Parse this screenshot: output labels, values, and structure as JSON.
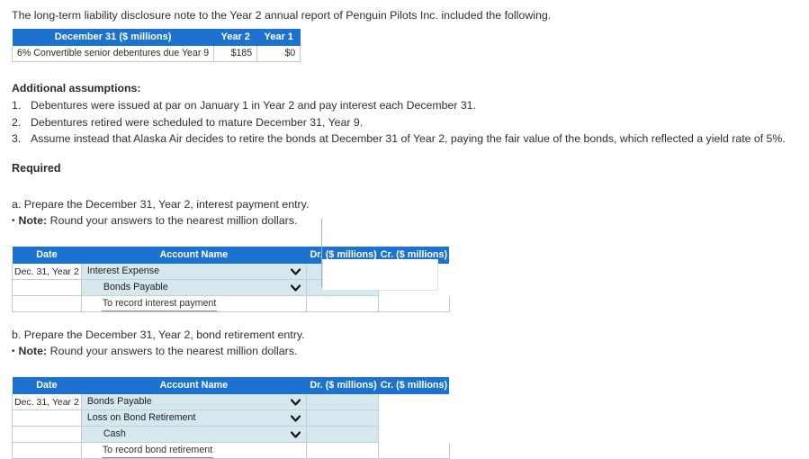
{
  "intro": {
    "text": "The long-term liability disclosure note to the Year 2 annual report of Penguin Pilots Inc. included the following."
  },
  "disclosure_table": {
    "headers": [
      "December 31 ($ millions)",
      "Year 2",
      "Year 1"
    ],
    "rows": [
      {
        "description": "6% Convertible senior debentures due Year 9",
        "year2": "$185",
        "year1": "$0"
      }
    ]
  },
  "assumptions": {
    "title": "Additional assumptions:",
    "items": [
      {
        "num": "1.",
        "text": "Debentures were issued at par on January 1 in Year 2 and pay interest each December 31."
      },
      {
        "num": "2.",
        "text": "Debentures retired were scheduled to mature December 31, Year 9."
      },
      {
        "num": "3.",
        "text": "Assume instead that Alaska Air decides to retire the bonds at December 31 of Year 2, paying the fair value of the bonds, which reflected a yield rate of 5%."
      }
    ]
  },
  "required": {
    "heading": "Required"
  },
  "part_a": {
    "prompt": "a. Prepare the December 31, Year 2, interest payment entry.",
    "bullet": "•",
    "note_label": "Note:",
    "note_text": "Round your answers to the nearest million dollars.",
    "table": {
      "headers": [
        "Date",
        "Account Name",
        "Dr. ($ millions)",
        "Cr. ($ millions)"
      ],
      "rows": [
        {
          "date": "Dec. 31, Year 2",
          "account": "Interest Expense",
          "indent": false,
          "dr": "",
          "cr": "",
          "type": "account"
        },
        {
          "date": "",
          "account": "Bonds Payable",
          "indent": true,
          "dr": "",
          "cr": "",
          "type": "account"
        },
        {
          "date": "",
          "account": "To record interest payment",
          "indent": false,
          "dr": "",
          "cr": "",
          "type": "memo"
        }
      ]
    }
  },
  "part_b": {
    "prompt": "b. Prepare the December 31, Year 2, bond retirement entry.",
    "bullet": "•",
    "note_label": "Note:",
    "note_text": "Round your answers to the nearest million dollars.",
    "table": {
      "headers": [
        "Date",
        "Account Name",
        "Dr. ($ millions)",
        "Cr. ($ millions)"
      ],
      "rows": [
        {
          "date": "Dec. 31, Year 2",
          "account": "Bonds Payable",
          "indent": false,
          "dr": "",
          "cr": "",
          "type": "account"
        },
        {
          "date": "",
          "account": "Loss on Bond Retirement",
          "indent": false,
          "dr": "",
          "cr": "",
          "type": "account"
        },
        {
          "date": "",
          "account": "Cash",
          "indent": true,
          "dr": "",
          "cr": "",
          "type": "account"
        },
        {
          "date": "",
          "account": "To record bond retirement",
          "indent": false,
          "dr": "",
          "cr": "",
          "type": "memo"
        }
      ]
    }
  },
  "icons": {
    "dropdown": "chevron-down-icon"
  },
  "colors": {
    "header_blue": "#1b72d0",
    "field_tint": "#d7e7ee",
    "border_gray": "#c9c9c9",
    "text": "#2b2b2b"
  }
}
